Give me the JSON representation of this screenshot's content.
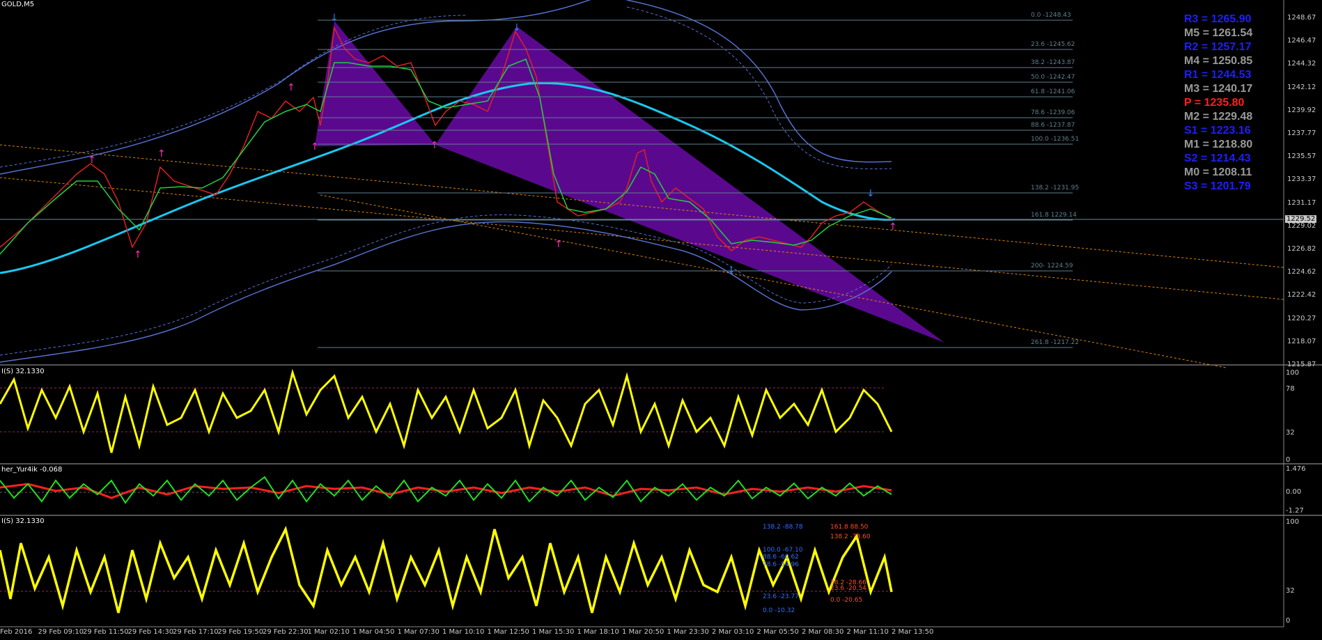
{
  "symbol": "GOLD,M5",
  "price_axis": [
    "1248.67",
    "1246.47",
    "1244.32",
    "1242.12",
    "1239.92",
    "1237.77",
    "1235.57",
    "1233.37",
    "1231.17",
    "1229.02",
    "1226.82",
    "1224.62",
    "1222.42",
    "1220.27",
    "1218.07",
    "1215.87"
  ],
  "current_price": "1229.52",
  "fib_levels": [
    "0.0 -1248.43",
    "23.6 -1245.62",
    "38.2 -1243.87",
    "50.0 -1242.47",
    "61.8 -1241.06",
    "78.6 -1239.06",
    "88.6 -1237.87",
    "100.0 -1236.51",
    "138.2 -1231.95",
    "161.8 1229.14",
    "200- 1224.59",
    "261.8 -1217.22"
  ],
  "pivots": [
    {
      "text": "R3 = 1265.90",
      "color": "#1e1eff"
    },
    {
      "text": "M5 = 1261.54",
      "color": "#9a9a9a"
    },
    {
      "text": "R2 = 1257.17",
      "color": "#1e1eff"
    },
    {
      "text": "M4 = 1250.85",
      "color": "#9a9a9a"
    },
    {
      "text": "R1 = 1244.53",
      "color": "#1e1eff"
    },
    {
      "text": "M3 = 1240.17",
      "color": "#9a9a9a"
    },
    {
      "text": "P  = 1235.80",
      "color": "#ff2020"
    },
    {
      "text": "M2 = 1229.48",
      "color": "#9a9a9a"
    },
    {
      "text": "S1 = 1223.16",
      "color": "#1e1eff"
    },
    {
      "text": "M1 = 1218.80",
      "color": "#9a9a9a"
    },
    {
      "text": "S2 = 1214.43",
      "color": "#1e1eff"
    },
    {
      "text": "M0 = 1208.11",
      "color": "#9a9a9a"
    },
    {
      "text": "S3 = 1201.79",
      "color": "#1e1eff"
    }
  ],
  "indicator1": {
    "title": "I(S) 32.1330",
    "scale": [
      "100",
      "78",
      "32",
      "0"
    ]
  },
  "indicator2": {
    "title": "her_Yur4ik -0.068",
    "scale": [
      "1.476",
      "0.00",
      "-1.27"
    ]
  },
  "indicator3": {
    "title": "I(S) 32.1330",
    "scale": [
      "100",
      "32",
      "0"
    ]
  },
  "ind3_fib_left": [
    "138.2 -88.78",
    "100.0 -67.10",
    "88.6 -60.62",
    "78.6 -54.96",
    "23.6 -23.77",
    "0.0 -10.32"
  ],
  "ind3_fib_right": [
    "161.8 88.50",
    "138.2 -78.60",
    "38.2 -28.66",
    "23.6 -20.54",
    "0.0 -20.65"
  ],
  "time_axis": [
    "Feb 2016",
    "29 Feb 09:10",
    "29 Feb 11:50",
    "29 Feb 14:30",
    "29 Feb 17:10",
    "29 Feb 19:50",
    "29 Feb 22:30",
    "1 Mar 02:10",
    "1 Mar 04:50",
    "1 Mar 07:30",
    "1 Mar 10:10",
    "1 Mar 12:50",
    "1 Mar 15:30",
    "1 Mar 18:10",
    "1 Mar 20:50",
    "1 Mar 23:30",
    "2 Mar 03:10",
    "2 Mar 05:50",
    "2 Mar 08:30",
    "2 Mar 11:10",
    "2 Mar 13:50"
  ],
  "colors": {
    "background": "#000000",
    "harmonic": "#6a0aa8",
    "ma": "#19c8f0",
    "yellow": "#ffff00",
    "fib": "#5f7f8f"
  }
}
